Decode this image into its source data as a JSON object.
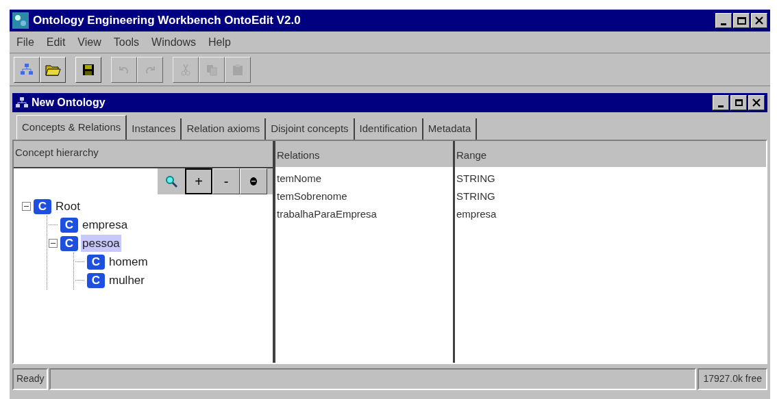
{
  "window": {
    "title": "Ontology Engineering Workbench OntoEdit V2.0"
  },
  "menu": [
    "File",
    "Edit",
    "View",
    "Tools",
    "Windows",
    "Help"
  ],
  "toolbar": [
    [
      {
        "kind": "hierarchy",
        "disabled": false
      },
      {
        "kind": "open",
        "disabled": false
      }
    ],
    [
      {
        "kind": "save",
        "disabled": false
      }
    ],
    [
      {
        "kind": "undo",
        "disabled": true
      },
      {
        "kind": "redo",
        "disabled": true
      }
    ],
    [
      {
        "kind": "cut",
        "disabled": true
      },
      {
        "kind": "copy",
        "disabled": true
      },
      {
        "kind": "paste",
        "disabled": true
      }
    ]
  ],
  "document": {
    "title": "New Ontology"
  },
  "tabs": [
    {
      "label": "Concepts & Relations",
      "selected": true
    },
    {
      "label": "Instances",
      "selected": false
    },
    {
      "label": "Relation axioms",
      "selected": false
    },
    {
      "label": "Disjoint concepts",
      "selected": false
    },
    {
      "label": "Identification",
      "selected": false
    },
    {
      "label": "Metadata",
      "selected": false
    }
  ],
  "concept_hierarchy": {
    "title": "Concept hierarchy",
    "buttons": [
      "+",
      "-"
    ],
    "tree": [
      {
        "label": "Root",
        "icon": "C",
        "expanded": true,
        "selected": false,
        "children": [
          {
            "label": "empresa",
            "icon": "C",
            "selected": false
          },
          {
            "label": "pessoa",
            "icon": "C",
            "expanded": true,
            "selected": true,
            "children": [
              {
                "label": "homem",
                "icon": "C",
                "selected": false
              },
              {
                "label": "mulher",
                "icon": "C",
                "selected": false
              }
            ]
          }
        ]
      }
    ]
  },
  "relations_table": {
    "columns": [
      "Relations",
      "Range"
    ],
    "rows": [
      [
        "temNome",
        "STRING"
      ],
      [
        "temSobrenome",
        "STRING"
      ],
      [
        "trabalhaParaEmpresa",
        "empresa"
      ]
    ]
  },
  "status_bar": {
    "message": "Ready",
    "memory": "17927.0k free"
  }
}
